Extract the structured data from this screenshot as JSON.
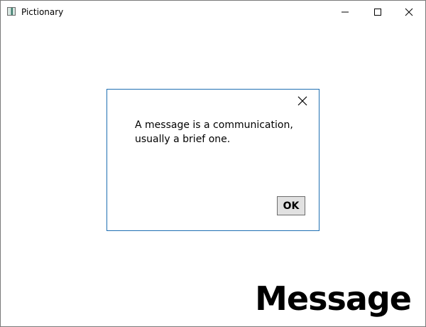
{
  "window": {
    "title": "Pictionary",
    "icon": "app-icon",
    "controls": [
      "minimize-icon",
      "maximize-icon",
      "close-icon"
    ]
  },
  "dialog": {
    "message": "A message is a communication, usually a brief one.",
    "ok_label": "OK",
    "close_icon": "close-icon",
    "border_color": "#1f6fb3"
  },
  "main": {
    "word": "Message"
  }
}
